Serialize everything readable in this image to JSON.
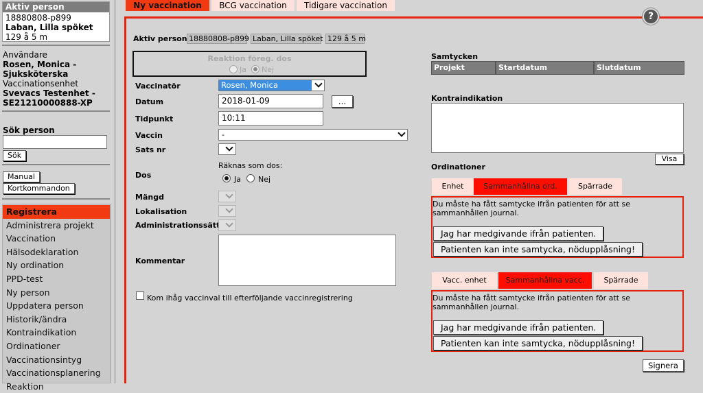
{
  "sidebar": {
    "aktiv_person_header": "Aktiv person",
    "person_id": "18880808-p899",
    "person_name": "Laban, Lilla spöket",
    "person_age": "129 å 5 m",
    "anvandare_label": "Användare",
    "user_name_line1": "Rosen, Monica -",
    "user_name_line2": "Sjuksköterska",
    "enhet_label": "Vaccinationsenhet",
    "unit_line1": "Svevacs Testenhet -",
    "unit_line2": "SE21210000888-XP",
    "sok_label": "Sök person",
    "sok_value": "",
    "sok_button": "Sök",
    "manual_button": "Manual",
    "kort_button": "Kortkommandon",
    "menu": [
      "Registrera",
      "Administrera projekt",
      "Vaccination",
      "Hälsodeklaration",
      "Ny ordination",
      "PPD-test",
      "Ny person",
      "Uppdatera person",
      "Historik/ändra",
      "Kontraindikation",
      "Ordinationer",
      "Vaccinationsintyg",
      "Vaccinationsplanering",
      "Reaktion"
    ]
  },
  "tabs": [
    "Ny vaccination",
    "BCG vaccination",
    "Tidigare vaccination"
  ],
  "help_icon": "?",
  "aktiv_bar": {
    "label": "Aktiv person",
    "id": "18880808-p899",
    "name": "Laban, Lilla spöket",
    "age": "129 å 5 m"
  },
  "reaktion": {
    "label": "Reaktion föreg. dos",
    "ja": "Ja",
    "nej": "Nej"
  },
  "form": {
    "vaccinator_label": "Vaccinatör",
    "vaccinator_value": "Rosen, Monica",
    "datum_label": "Datum",
    "datum_value": "2018-01-09",
    "datum_button": "...",
    "tidpunkt_label": "Tidpunkt",
    "tidpunkt_value": "10:11",
    "vaccin_label": "Vaccin",
    "vaccin_value": "-",
    "sats_label": "Sats nr",
    "dos_label": "Dos",
    "raknas_label": "Räknas som dos:",
    "dos_ja": "Ja",
    "dos_nej": "Nej",
    "mangd_label": "Mängd",
    "lokalisation_label": "Lokalisation",
    "admin_label": "Administrationssätt",
    "kommentar_label": "Kommentar",
    "kommentar_value": "",
    "remember_label": "Kom ihåg vaccinval till efterföljande vaccinregistrering"
  },
  "right": {
    "samtycken_label": "Samtycken",
    "samtycken_cols": [
      "Projekt",
      "Startdatum",
      "Slutdatum"
    ],
    "kontra_label": "Kontraindikation",
    "visa_button": "Visa",
    "ordinationer_label": "Ordinationer",
    "ord_tabs": [
      "Enhet",
      "Sammanhållna ord.",
      "Spärrade"
    ],
    "vacc_tabs": [
      "Vacc. enhet",
      "Sammanhållna vacc.",
      "Spärrade"
    ],
    "consent_msg": "Du måste ha fått samtycke ifrån patienten för att se sammanhållen journal.",
    "consent_btn1": "Jag har medgivande ifrån patienten.",
    "consent_btn2": "Patienten kan inte samtycka, nödupplåsning!",
    "signera_button": "Signera"
  }
}
